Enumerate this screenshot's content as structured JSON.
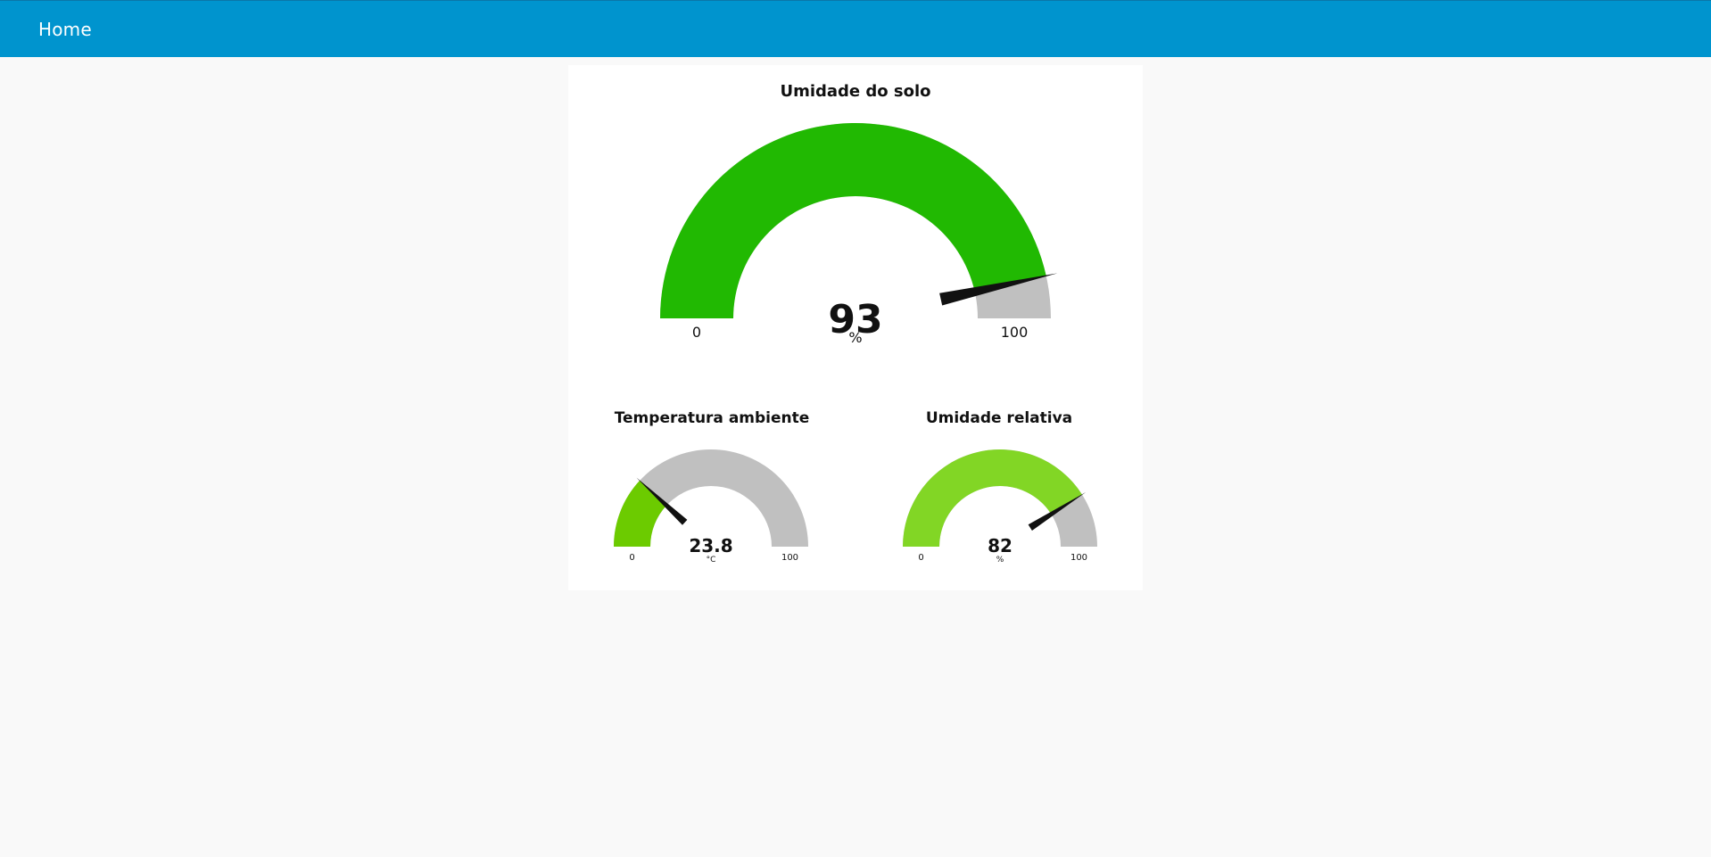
{
  "header": {
    "title": "Home"
  },
  "gauges": [
    {
      "id": "solo",
      "title": "Umidade do solo",
      "value": "93",
      "units": "%",
      "min": "0",
      "max": "100",
      "fill_color": "#21b902",
      "track_color": "#c0c0c0"
    },
    {
      "id": "temp",
      "title": "Temperatura ambiente",
      "value": "23.8",
      "units": "°C",
      "min": "0",
      "max": "100",
      "fill_color": "#6ccb00",
      "track_color": "#c0c0c0"
    },
    {
      "id": "rel",
      "title": "Umidade relativa",
      "value": "82",
      "units": "%",
      "min": "0",
      "max": "100",
      "fill_color": "#82d625",
      "track_color": "#c0c0c0"
    }
  ],
  "colors": {
    "header_bg": "#0094ce",
    "page_bg": "#f9f9f9",
    "card_bg": "#ffffff",
    "needle": "#111111"
  }
}
